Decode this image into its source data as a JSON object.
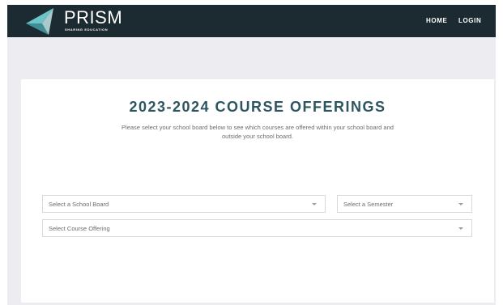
{
  "brand": {
    "name": "PRISM",
    "tagline": "SHARING EDUCATION"
  },
  "nav": {
    "home": "HOME",
    "login": "LOGIN"
  },
  "main": {
    "title": "2023-2024 COURSE OFFERINGS",
    "description": "Please select your school board below to see which courses are offered within your school board and outside your school board."
  },
  "filters": {
    "school_board": "Select a School Board",
    "semester": "Select a Semester",
    "course_offering": "Select Course Offering"
  },
  "colors": {
    "navbar": "#1c2a31",
    "title": "#2c5560",
    "page_bg": "#ececf1"
  }
}
